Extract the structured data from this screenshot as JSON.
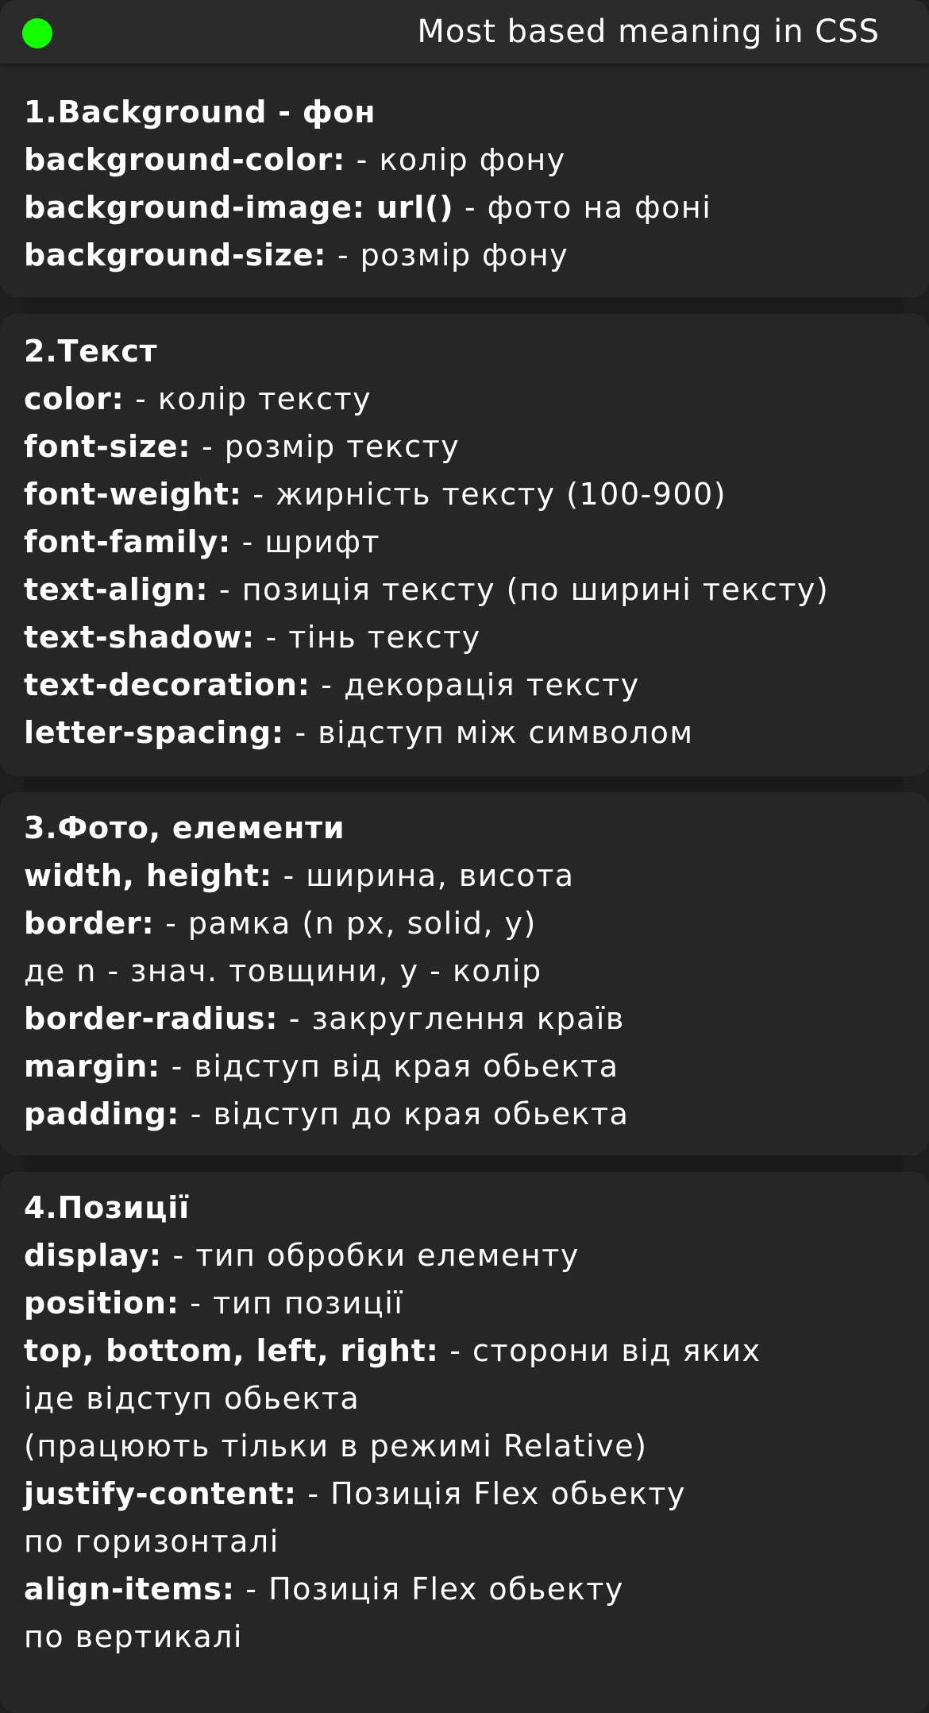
{
  "window": {
    "title": "Most based meaning in CSS",
    "status_color": "#12ff00"
  },
  "sections": [
    {
      "lines": [
        {
          "k": "1.Background - фон",
          "d": ""
        },
        {
          "k": "background-color:",
          "d": " - колір фону"
        },
        {
          "k": "background-image: url()",
          "d": " - фото на фоні"
        },
        {
          "k": "background-size:",
          "d": " - розмір фону"
        }
      ]
    },
    {
      "lines": [
        {
          "k": "2.Текст",
          "d": ""
        },
        {
          "k": "color:",
          "d": " - колір тексту"
        },
        {
          "k": "font-size:",
          "d": " - розмір тексту"
        },
        {
          "k": "font-weight:",
          "d": " - жирність тексту (100-900)"
        },
        {
          "k": "font-family:",
          "d": " - шрифт"
        },
        {
          "k": "text-align:",
          "d": " - позиція тексту (по ширині тексту)"
        },
        {
          "k": "text-shadow:",
          "d": " - тінь тексту"
        },
        {
          "k": "text-decoration:",
          "d": " - декорація тексту"
        },
        {
          "k": "letter-spacing:",
          "d": " - відступ між символом"
        }
      ]
    },
    {
      "lines": [
        {
          "k": "3.Фото, елементи",
          "d": ""
        },
        {
          "k": "width, height:",
          "d": " - ширина, висота"
        },
        {
          "k": "border:",
          "d": " - рамка (n px, solid, y)"
        },
        {
          "k": "",
          "d": "де n - знач. товщини, y - колір"
        },
        {
          "k": "border-radius:",
          "d": " - закруглення країв"
        },
        {
          "k": "margin:",
          "d": " -  відступ від края обьекта"
        },
        {
          "k": "padding:",
          "d": " - відступ до края обьекта"
        }
      ]
    },
    {
      "lines": [
        {
          "k": "4.Позиції",
          "d": ""
        },
        {
          "k": "display:",
          "d": " - тип обробки елементу"
        },
        {
          "k": "position:",
          "d": " - тип позиції"
        },
        {
          "k": "top, bottom, left, right:",
          "d": " - сторони від яких"
        },
        {
          "k": "",
          "d": "іде відступ обьекта"
        },
        {
          "k": "",
          "d": "(працюють тільки в режимі Relative)"
        },
        {
          "k": "justify-content:",
          "d": " - Позиція Flex обьекту"
        },
        {
          "k": "",
          "d": "по горизонталі"
        },
        {
          "k": "align-items:",
          "d": " - Позиція Flex обьекту"
        },
        {
          "k": "",
          "d": "по вертикалі"
        }
      ]
    }
  ]
}
